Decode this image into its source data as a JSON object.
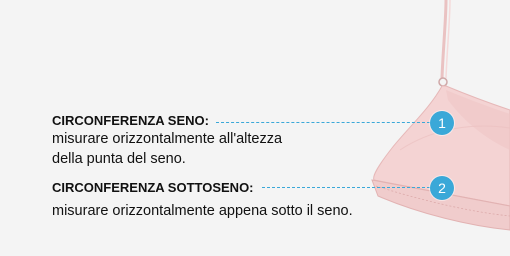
{
  "measurements": [
    {
      "number": "1",
      "title": "CIRCONFERENZA SENO:",
      "description_lines": [
        "misurare orizzontalmente all'altezza",
        "della punta del seno."
      ]
    },
    {
      "number": "2",
      "title": "CIRCONFERENZA SOTTOSENO:",
      "description_lines": [
        "misurare orizzontalmente appena sotto il seno."
      ]
    }
  ],
  "colors": {
    "background": "#f4f4f4",
    "accent": "#3aa8d8",
    "garment": "#f4d3d3",
    "text": "#111111"
  },
  "garment_icon": "bra-illustration"
}
